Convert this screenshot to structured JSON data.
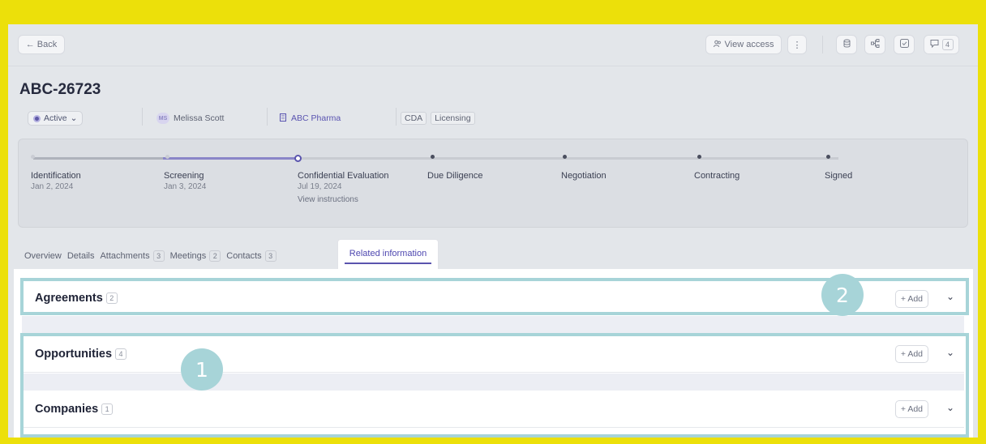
{
  "topbar": {
    "back_label": "← Back",
    "view_access_label": "View access",
    "more_label": "⋮",
    "comments_count": "4"
  },
  "record": {
    "id": "ABC-26723",
    "status": "Active",
    "owner_initials": "MS",
    "owner_name": "Melissa Scott",
    "company": "ABC Pharma",
    "tags": [
      "CDA",
      "Licensing"
    ]
  },
  "stages": [
    {
      "name": "Identification",
      "date": "Jan 2, 2024"
    },
    {
      "name": "Screening",
      "date": "Jan 3, 2024"
    },
    {
      "name": "Confidential Evaluation",
      "date": "Jul 19, 2024",
      "link": "View instructions"
    },
    {
      "name": "Due Diligence"
    },
    {
      "name": "Negotiation"
    },
    {
      "name": "Contracting"
    },
    {
      "name": "Signed"
    }
  ],
  "tabs": [
    {
      "label": "Overview"
    },
    {
      "label": "Details"
    },
    {
      "label": "Attachments",
      "count": "3"
    },
    {
      "label": "Meetings",
      "count": "2"
    },
    {
      "label": "Contacts",
      "count": "3"
    },
    {
      "label": "Related information"
    }
  ],
  "sections": [
    {
      "title": "Agreements",
      "count": "2",
      "add_label": "+ Add"
    },
    {
      "title": "Opportunities",
      "count": "4",
      "add_label": "+ Add"
    },
    {
      "title": "Companies",
      "count": "1",
      "add_label": "+ Add"
    }
  ],
  "callouts": [
    "1",
    "2"
  ],
  "colors": {
    "background": "#ece00a",
    "accent": "#5a54ae",
    "highlight": "#a7d4d8"
  }
}
